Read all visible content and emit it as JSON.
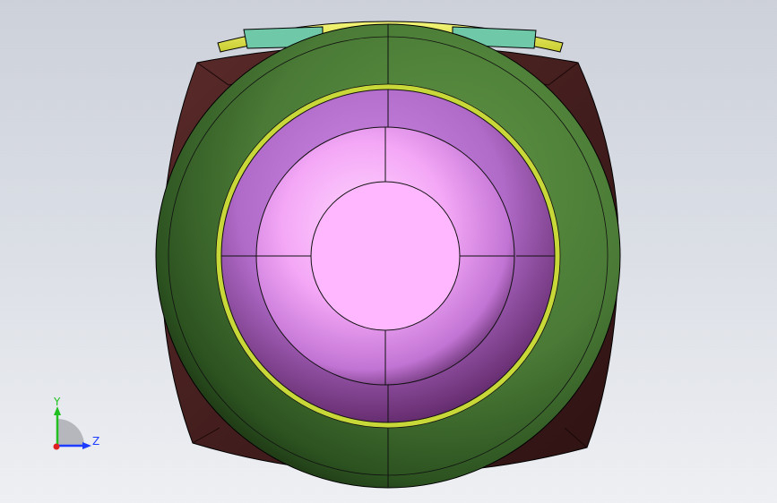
{
  "viewport": {
    "background": "#d4d8e0"
  },
  "model": {
    "colors": {
      "outer_body": "#4e2626",
      "outer_body_dark": "#351818",
      "ball": "#4a7a36",
      "ball_light": "#5e9242",
      "ball_dark": "#1f3a14",
      "seat_ring": "#c8d838",
      "bore": "#b46ad0",
      "bore_light": "#ffc8ff",
      "bore_dark": "#3c1840",
      "stem_cap": "#ecf056",
      "stem_block": "#6fc8a8"
    }
  },
  "triad": {
    "y_label": "Y",
    "z_label": "Z",
    "colors": {
      "y": "#20c020",
      "z": "#1e3cff",
      "x": "#e02020"
    }
  }
}
